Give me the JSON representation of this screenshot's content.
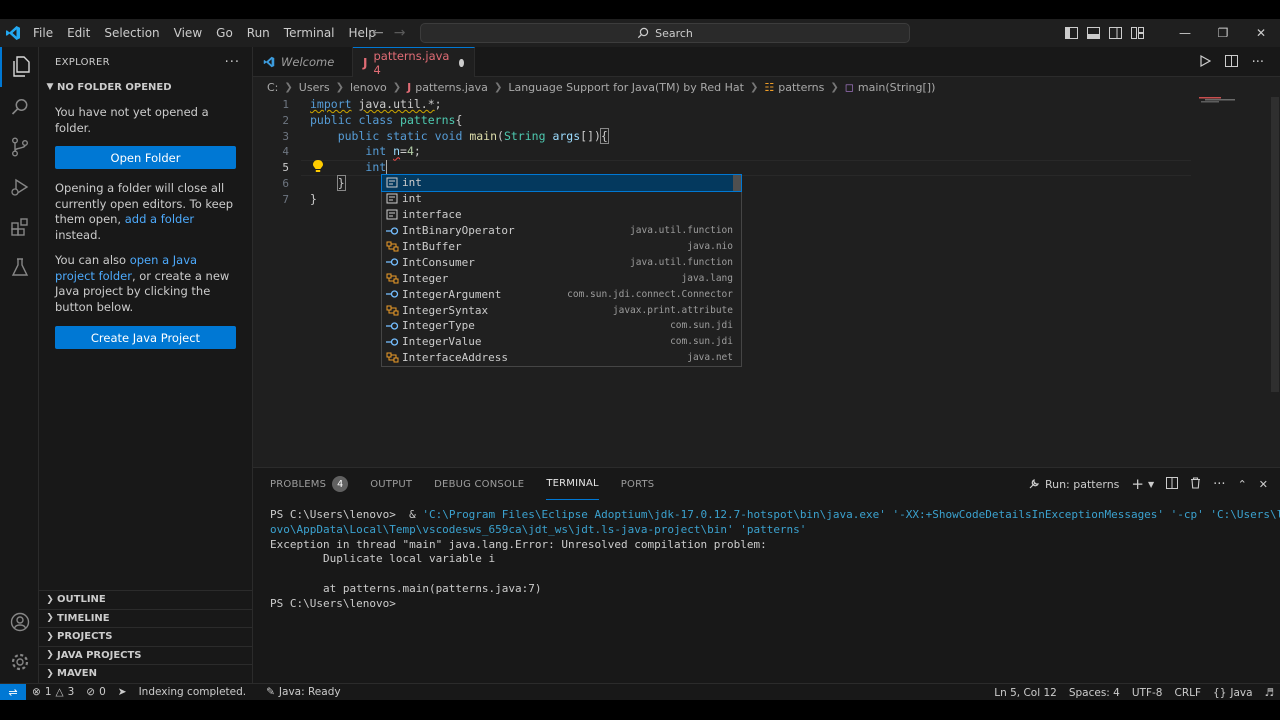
{
  "menu": [
    "File",
    "Edit",
    "Selection",
    "View",
    "Go",
    "Run",
    "Terminal",
    "Help"
  ],
  "search": {
    "label": "Search"
  },
  "sidebar": {
    "header": "EXPLORER",
    "section_title": "NO FOLDER OPENED",
    "no_folder_text": "You have not yet opened a folder.",
    "open_folder_button": "Open Folder",
    "info_text_1": "Opening a folder will close all currently open editors. To keep them open, ",
    "info_link_1": "add a folder",
    "info_text_1_end": " instead.",
    "info_text_2": "You can also ",
    "info_link_2": "open a Java project folder",
    "info_text_2_end": ", or create a new Java project by clicking the button below.",
    "create_java_button": "Create Java Project",
    "bottom_sections": [
      "OUTLINE",
      "TIMELINE",
      "PROJECTS",
      "JAVA PROJECTS",
      "MAVEN"
    ]
  },
  "tabs": {
    "welcome": "Welcome",
    "active": "patterns.java 4"
  },
  "breadcrumb": [
    "C:",
    "Users",
    "lenovo",
    "patterns.java",
    "Language Support for Java(TM) by Red Hat",
    "patterns",
    "main(String[])"
  ],
  "editor": {
    "line_numbers": [
      "1",
      "2",
      "3",
      "4",
      "5",
      "6",
      "7"
    ],
    "current_line": "5"
  },
  "suggestions": [
    {
      "label": "int",
      "match": "int",
      "rest": "",
      "detail": "",
      "kind": "snippet"
    },
    {
      "label": "int",
      "match": "int",
      "rest": "",
      "detail": "",
      "kind": "snippet"
    },
    {
      "label": "interface",
      "match": "int",
      "rest": "erface",
      "detail": "",
      "kind": "snippet"
    },
    {
      "label": "IntBinaryOperator",
      "match": "Int",
      "rest": "BinaryOperator",
      "detail": "java.util.function",
      "kind": "interface"
    },
    {
      "label": "IntBuffer",
      "match": "Int",
      "rest": "Buffer",
      "detail": "java.nio",
      "kind": "class"
    },
    {
      "label": "IntConsumer",
      "match": "Int",
      "rest": "Consumer",
      "detail": "java.util.function",
      "kind": "interface"
    },
    {
      "label": "Integer",
      "match": "Int",
      "rest": "eger",
      "detail": "java.lang",
      "kind": "class"
    },
    {
      "label": "IntegerArgument",
      "match": "Int",
      "rest": "egerArgument",
      "detail": "com.sun.jdi.connect.Connector",
      "kind": "interface"
    },
    {
      "label": "IntegerSyntax",
      "match": "Int",
      "rest": "egerSyntax",
      "detail": "javax.print.attribute",
      "kind": "class"
    },
    {
      "label": "IntegerType",
      "match": "Int",
      "rest": "egerType",
      "detail": "com.sun.jdi",
      "kind": "interface"
    },
    {
      "label": "IntegerValue",
      "match": "Int",
      "rest": "egerValue",
      "detail": "com.sun.jdi",
      "kind": "interface"
    },
    {
      "label": "InterfaceAddress",
      "match": "Int",
      "rest": "erfaceAddress",
      "detail": "java.net",
      "kind": "class"
    }
  ],
  "panel": {
    "tabs": [
      "PROBLEMS",
      "OUTPUT",
      "DEBUG CONSOLE",
      "TERMINAL",
      "PORTS"
    ],
    "problems_count": "4",
    "active_tab": "TERMINAL",
    "run_label": "Run: patterns",
    "terminal_lines": [
      {
        "prompt": "PS C:\\Users\\lenovo> ",
        "text": " & ",
        "str": "'C:\\Program Files\\Eclipse Adoptium\\jdk-17.0.12.7-hotspot\\bin\\java.exe' '-XX:+ShowCodeDetailsInExceptionMessages' '-cp' 'C:\\Users\\len"
      },
      {
        "prompt": "",
        "text": "",
        "str": "ovo\\AppData\\Local\\Temp\\vscodesws_659ca\\jdt_ws\\jdt.ls-java-project\\bin' 'patterns'"
      },
      {
        "prompt": "Exception in thread \"main\" java.lang.Error: Unresolved compilation problem:",
        "text": "",
        "str": ""
      },
      {
        "prompt": "        Duplicate local variable i",
        "text": "",
        "str": ""
      },
      {
        "prompt": "",
        "text": "",
        "str": ""
      },
      {
        "prompt": "        at patterns.main(patterns.java:7)",
        "text": "",
        "str": ""
      },
      {
        "prompt": "PS C:\\Users\\lenovo>",
        "text": "",
        "str": ""
      }
    ]
  },
  "statusbar": {
    "errors": "1",
    "warnings": "3",
    "ports": "0",
    "indexing": "Indexing completed.",
    "java_status": "Java: Ready",
    "position": "Ln 5, Col 12",
    "spaces": "Spaces: 4",
    "encoding": "UTF-8",
    "eol": "CRLF",
    "language": "Java"
  },
  "colors": {
    "accent": "#0078d4",
    "editor_bg": "#1f1f1f",
    "sidebar_bg": "#181818",
    "keyword": "#569cd6",
    "java_file": "#e06c75"
  }
}
